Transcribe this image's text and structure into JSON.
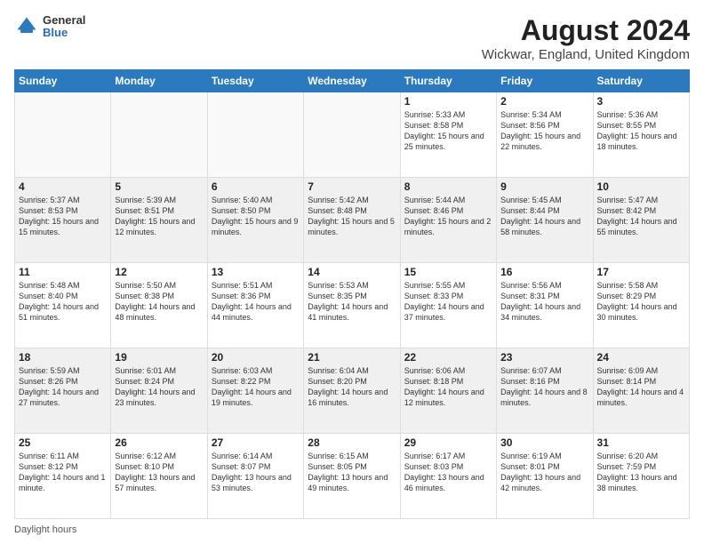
{
  "header": {
    "logo_general": "General",
    "logo_blue": "Blue",
    "main_title": "August 2024",
    "subtitle": "Wickwar, England, United Kingdom"
  },
  "footer": {
    "daylight_label": "Daylight hours"
  },
  "columns": [
    "Sunday",
    "Monday",
    "Tuesday",
    "Wednesday",
    "Thursday",
    "Friday",
    "Saturday"
  ],
  "weeks": [
    [
      {
        "day": "",
        "info": ""
      },
      {
        "day": "",
        "info": ""
      },
      {
        "day": "",
        "info": ""
      },
      {
        "day": "",
        "info": ""
      },
      {
        "day": "1",
        "info": "Sunrise: 5:33 AM\nSunset: 8:58 PM\nDaylight: 15 hours and 25 minutes."
      },
      {
        "day": "2",
        "info": "Sunrise: 5:34 AM\nSunset: 8:56 PM\nDaylight: 15 hours and 22 minutes."
      },
      {
        "day": "3",
        "info": "Sunrise: 5:36 AM\nSunset: 8:55 PM\nDaylight: 15 hours and 18 minutes."
      }
    ],
    [
      {
        "day": "4",
        "info": "Sunrise: 5:37 AM\nSunset: 8:53 PM\nDaylight: 15 hours and 15 minutes."
      },
      {
        "day": "5",
        "info": "Sunrise: 5:39 AM\nSunset: 8:51 PM\nDaylight: 15 hours and 12 minutes."
      },
      {
        "day": "6",
        "info": "Sunrise: 5:40 AM\nSunset: 8:50 PM\nDaylight: 15 hours and 9 minutes."
      },
      {
        "day": "7",
        "info": "Sunrise: 5:42 AM\nSunset: 8:48 PM\nDaylight: 15 hours and 5 minutes."
      },
      {
        "day": "8",
        "info": "Sunrise: 5:44 AM\nSunset: 8:46 PM\nDaylight: 15 hours and 2 minutes."
      },
      {
        "day": "9",
        "info": "Sunrise: 5:45 AM\nSunset: 8:44 PM\nDaylight: 14 hours and 58 minutes."
      },
      {
        "day": "10",
        "info": "Sunrise: 5:47 AM\nSunset: 8:42 PM\nDaylight: 14 hours and 55 minutes."
      }
    ],
    [
      {
        "day": "11",
        "info": "Sunrise: 5:48 AM\nSunset: 8:40 PM\nDaylight: 14 hours and 51 minutes."
      },
      {
        "day": "12",
        "info": "Sunrise: 5:50 AM\nSunset: 8:38 PM\nDaylight: 14 hours and 48 minutes."
      },
      {
        "day": "13",
        "info": "Sunrise: 5:51 AM\nSunset: 8:36 PM\nDaylight: 14 hours and 44 minutes."
      },
      {
        "day": "14",
        "info": "Sunrise: 5:53 AM\nSunset: 8:35 PM\nDaylight: 14 hours and 41 minutes."
      },
      {
        "day": "15",
        "info": "Sunrise: 5:55 AM\nSunset: 8:33 PM\nDaylight: 14 hours and 37 minutes."
      },
      {
        "day": "16",
        "info": "Sunrise: 5:56 AM\nSunset: 8:31 PM\nDaylight: 14 hours and 34 minutes."
      },
      {
        "day": "17",
        "info": "Sunrise: 5:58 AM\nSunset: 8:29 PM\nDaylight: 14 hours and 30 minutes."
      }
    ],
    [
      {
        "day": "18",
        "info": "Sunrise: 5:59 AM\nSunset: 8:26 PM\nDaylight: 14 hours and 27 minutes."
      },
      {
        "day": "19",
        "info": "Sunrise: 6:01 AM\nSunset: 8:24 PM\nDaylight: 14 hours and 23 minutes."
      },
      {
        "day": "20",
        "info": "Sunrise: 6:03 AM\nSunset: 8:22 PM\nDaylight: 14 hours and 19 minutes."
      },
      {
        "day": "21",
        "info": "Sunrise: 6:04 AM\nSunset: 8:20 PM\nDaylight: 14 hours and 16 minutes."
      },
      {
        "day": "22",
        "info": "Sunrise: 6:06 AM\nSunset: 8:18 PM\nDaylight: 14 hours and 12 minutes."
      },
      {
        "day": "23",
        "info": "Sunrise: 6:07 AM\nSunset: 8:16 PM\nDaylight: 14 hours and 8 minutes."
      },
      {
        "day": "24",
        "info": "Sunrise: 6:09 AM\nSunset: 8:14 PM\nDaylight: 14 hours and 4 minutes."
      }
    ],
    [
      {
        "day": "25",
        "info": "Sunrise: 6:11 AM\nSunset: 8:12 PM\nDaylight: 14 hours and 1 minute."
      },
      {
        "day": "26",
        "info": "Sunrise: 6:12 AM\nSunset: 8:10 PM\nDaylight: 13 hours and 57 minutes."
      },
      {
        "day": "27",
        "info": "Sunrise: 6:14 AM\nSunset: 8:07 PM\nDaylight: 13 hours and 53 minutes."
      },
      {
        "day": "28",
        "info": "Sunrise: 6:15 AM\nSunset: 8:05 PM\nDaylight: 13 hours and 49 minutes."
      },
      {
        "day": "29",
        "info": "Sunrise: 6:17 AM\nSunset: 8:03 PM\nDaylight: 13 hours and 46 minutes."
      },
      {
        "day": "30",
        "info": "Sunrise: 6:19 AM\nSunset: 8:01 PM\nDaylight: 13 hours and 42 minutes."
      },
      {
        "day": "31",
        "info": "Sunrise: 6:20 AM\nSunset: 7:59 PM\nDaylight: 13 hours and 38 minutes."
      }
    ]
  ]
}
